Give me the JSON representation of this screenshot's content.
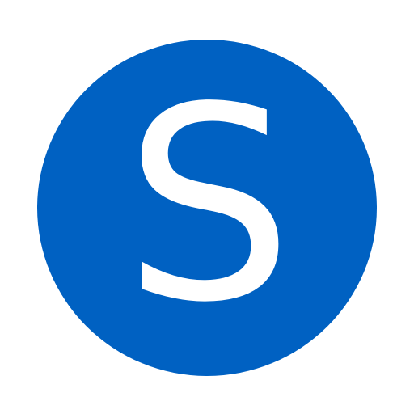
{
  "icon": {
    "name": "letter-s-circle-icon",
    "letter": "S",
    "background_color": "#0061c2",
    "letter_color": "#ffffff",
    "page_background": "#ffffff"
  }
}
